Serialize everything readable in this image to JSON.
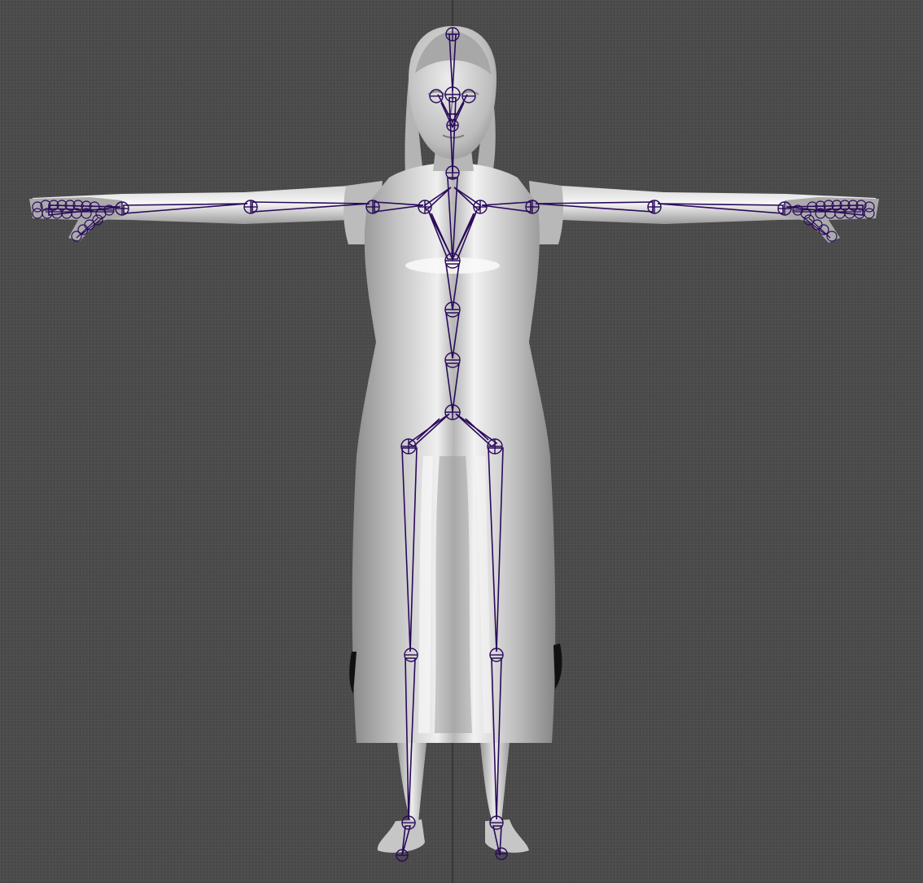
{
  "viewport": {
    "background_color": "#4a4a4a",
    "grid_line_color": "#565656",
    "axis_line_color": "#2e2e2e",
    "mesh_base_color": "#b9b9b9",
    "mesh_highlight_color": "#f4f4f4",
    "mesh_shadow_color": "#7d7d7d",
    "joint_color": "#2a0a5a"
  },
  "scene": {
    "object": "character-mesh",
    "pose": "T-pose",
    "rig": "skeleton-joints"
  }
}
